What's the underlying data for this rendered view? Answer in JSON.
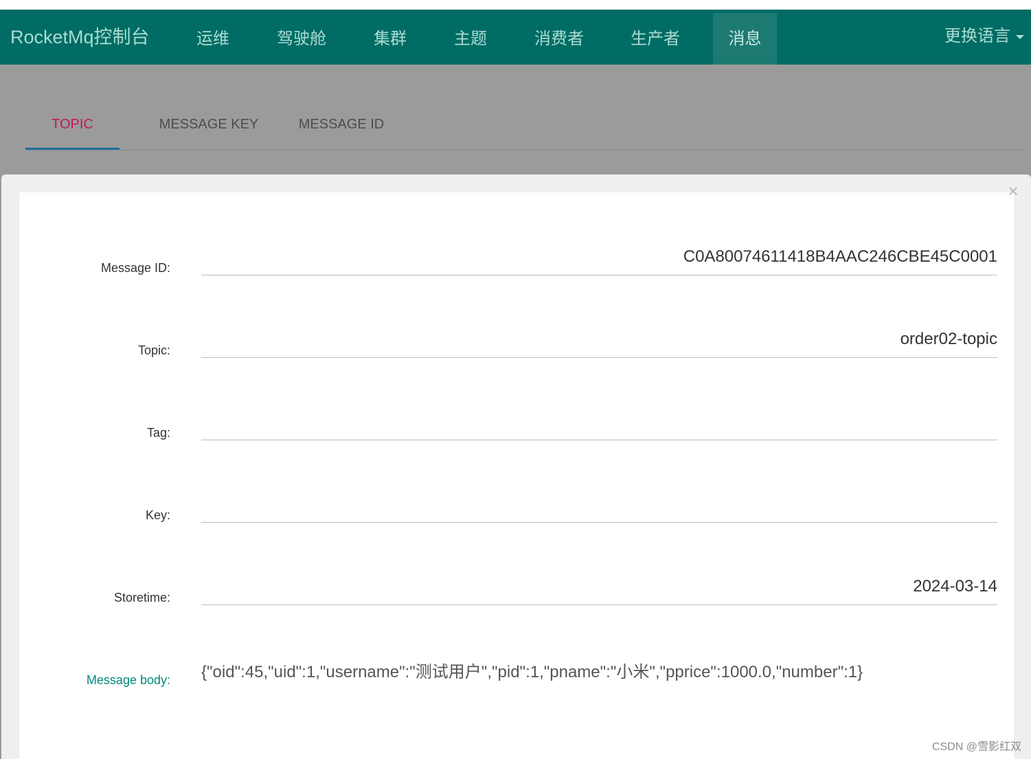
{
  "navbar": {
    "brand": "RocketMq控制台",
    "items": [
      "运维",
      "驾驶舱",
      "集群",
      "主题",
      "消费者",
      "生产者",
      "消息"
    ],
    "active_item": "消息",
    "language_label": "更换语言"
  },
  "tabs": {
    "items": [
      "TOPIC",
      "MESSAGE KEY",
      "MESSAGE ID"
    ],
    "active": "TOPIC"
  },
  "modal": {
    "close_label": "×",
    "fields": [
      {
        "label": "Message ID:",
        "value": "C0A80074611418B4AAC246CBE45C0001"
      },
      {
        "label": "Topic:",
        "value": "order02-topic"
      },
      {
        "label": "Tag:",
        "value": ""
      },
      {
        "label": "Key:",
        "value": ""
      },
      {
        "label": "Storetime:",
        "value": "2024-03-14"
      }
    ],
    "body_label": "Message body:",
    "body_value": "{\"oid\":45,\"uid\":1,\"username\":\"测试用户\",\"pid\":1,\"pname\":\"小米\",\"pprice\":1000.0,\"number\":1}"
  },
  "watermark": "CSDN @雪影红双",
  "colors": {
    "navbar_bg": "#006c64",
    "active_tab_text": "#c2185b",
    "active_tab_underline": "#1e6fa0",
    "body_label": "#00897b"
  }
}
